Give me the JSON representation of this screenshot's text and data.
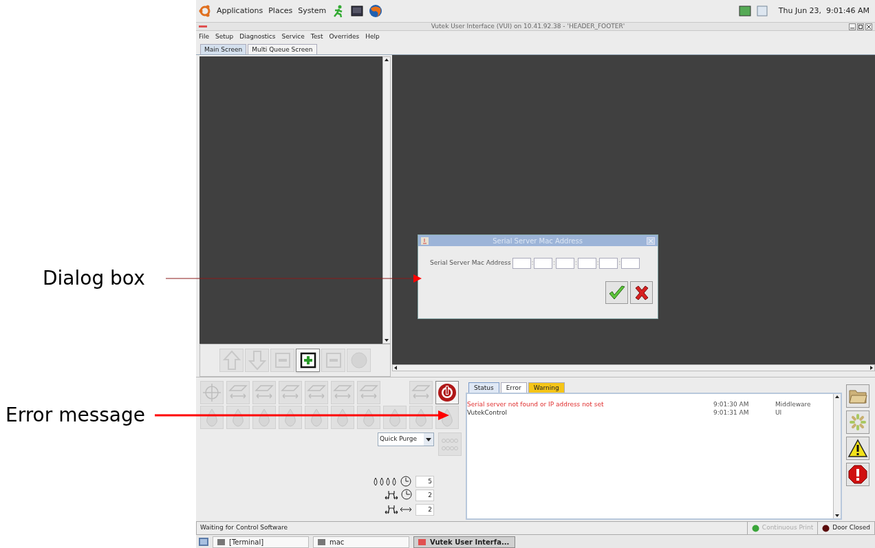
{
  "annotations": [
    {
      "kind": "thin",
      "label": "Dialog box"
    },
    {
      "kind": "bold",
      "label": "Error message"
    }
  ],
  "top_panel": {
    "menus": [
      "Applications",
      "Places",
      "System"
    ],
    "clock": "Thu Jun 23,  9:01:46 AM"
  },
  "window": {
    "title": "Vutek User Interface (VUI) on 10.41.92.38 - 'HEADER_FOOTER'",
    "menu": [
      "File",
      "Setup",
      "Diagnostics",
      "Service",
      "Test",
      "Overrides",
      "Help"
    ],
    "tabs": [
      {
        "label": "Main Screen",
        "selected": true
      },
      {
        "label": "Multi Queue Screen",
        "selected": false
      }
    ]
  },
  "queue_buttons": [
    {
      "kind": "up",
      "disabled": true
    },
    {
      "kind": "down",
      "disabled": true
    },
    {
      "kind": "minus",
      "disabled": true
    },
    {
      "kind": "plus",
      "disabled": false
    },
    {
      "kind": "minus",
      "disabled": true
    },
    {
      "kind": "circle",
      "disabled": true
    }
  ],
  "dialog": {
    "title": "Serial Server Mac Address",
    "label": "Serial Server Mac Address",
    "separators": [
      ":",
      ":",
      ":",
      ":",
      ":"
    ]
  },
  "tool_buttons": [
    {
      "kind": "target",
      "disabled": true
    },
    {
      "kind": "tool",
      "disabled": true
    },
    {
      "kind": "tool",
      "disabled": true
    },
    {
      "kind": "tool",
      "disabled": true
    },
    {
      "kind": "tool",
      "disabled": true
    },
    {
      "kind": "tool",
      "disabled": true
    },
    {
      "kind": "tool",
      "disabled": true
    },
    {
      "kind": "tool",
      "disabled": true
    },
    {
      "kind": "power",
      "disabled": false
    }
  ],
  "ink_buttons": [
    {
      "disabled": true
    },
    {
      "disabled": true
    },
    {
      "disabled": true
    },
    {
      "disabled": true
    },
    {
      "disabled": true
    },
    {
      "disabled": true
    },
    {
      "disabled": true
    },
    {
      "disabled": true
    },
    {
      "disabled": true
    },
    {
      "disabled": true
    }
  ],
  "purge": {
    "value": "Quick Purge"
  },
  "settings": [
    {
      "kind": "drops",
      "value": "5"
    },
    {
      "kind": "clock",
      "value": "2"
    },
    {
      "kind": "width",
      "value": "2"
    }
  ],
  "log": {
    "tabs": [
      {
        "label": "Status",
        "selected": true,
        "color": "#dfe8f5"
      },
      {
        "label": "Error",
        "selected": false,
        "color": "#ffffff"
      },
      {
        "label": "Warning",
        "selected": false,
        "color": "#f5c518"
      }
    ],
    "entries": [
      {
        "message": "Serial server not found or IP address not set",
        "time": "9:01:30 AM",
        "source": "Middleware",
        "kind": "error"
      },
      {
        "message": "VutekControl",
        "time": "9:01:31 AM",
        "source": "UI",
        "kind": "info"
      }
    ]
  },
  "side_buttons": [
    {
      "kind": "folder"
    },
    {
      "kind": "burst"
    },
    {
      "kind": "warning"
    },
    {
      "kind": "stop"
    }
  ],
  "status_bar": {
    "message": "Waiting for Control Software",
    "indicators": [
      {
        "label": "Continuous Print",
        "color": "#3aa53a",
        "disabled": true
      },
      {
        "label": "Door Closed",
        "color": "#5a0a0a",
        "disabled": false
      }
    ]
  },
  "taskbar": [
    {
      "label": "[Terminal]",
      "selected": false
    },
    {
      "label": "mac",
      "selected": false
    },
    {
      "label": "Vutek User Interfa...",
      "selected": true
    }
  ]
}
